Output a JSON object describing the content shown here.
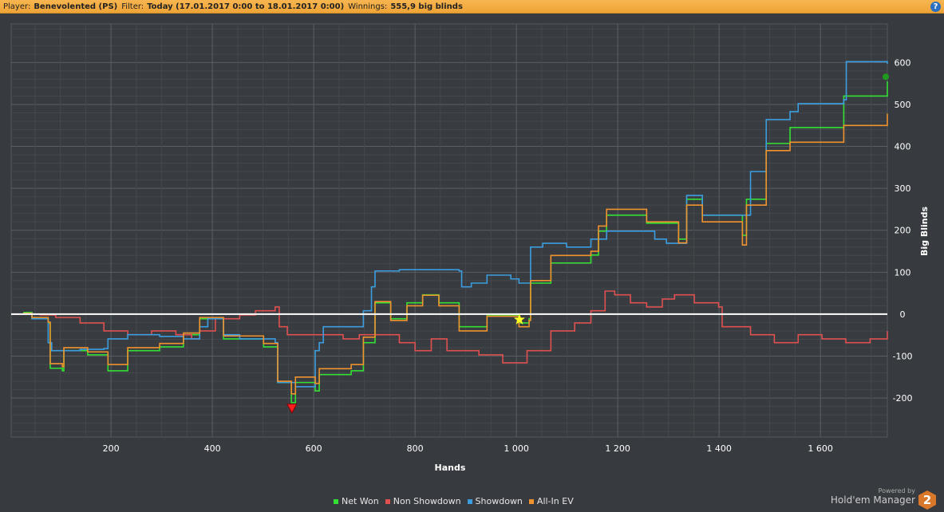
{
  "header": {
    "player_label": "Player:",
    "player": "Benevolented (PS)",
    "filter_label": "Filter:",
    "filter": "Today (17.01.2017 0:00 to 18.01.2017 0:00)",
    "winnings_label": "Winnings:",
    "winnings": "555,9 big blinds",
    "help": "?"
  },
  "branding": {
    "powered_by": "Powered by",
    "name": "Hold'em Manager",
    "logo": "2"
  },
  "chart_data": {
    "type": "line",
    "title": "",
    "xlabel": "Hands",
    "ylabel": "Big Blinds",
    "xlim": [
      3,
      1732
    ],
    "ylim": [
      -293,
      692
    ],
    "x_ticks": [
      200,
      400,
      600,
      800,
      1000,
      1200,
      1400,
      1600
    ],
    "x_tick_labels": [
      "200",
      "400",
      "600",
      "800",
      "1 000",
      "1 200",
      "1 400",
      "1 600"
    ],
    "y_ticks": [
      -200,
      -100,
      0,
      100,
      200,
      300,
      400,
      500,
      600
    ],
    "y_tick_labels": [
      "-200",
      "-100",
      "0",
      "100",
      "200",
      "300",
      "400",
      "500",
      "600"
    ],
    "grid": true,
    "legend_position": "bottom-center",
    "series": [
      {
        "name": "Net Won",
        "color": "#33e033",
        "points": [
          [
            3,
            0
          ],
          [
            28,
            4
          ],
          [
            44,
            -11
          ],
          [
            76,
            -21
          ],
          [
            80,
            -129
          ],
          [
            104,
            -135
          ],
          [
            107,
            -87
          ],
          [
            154,
            -97
          ],
          [
            194,
            -135
          ],
          [
            233,
            -87
          ],
          [
            296,
            -78
          ],
          [
            343,
            -49
          ],
          [
            375,
            -11
          ],
          [
            398,
            -11
          ],
          [
            422,
            -59
          ],
          [
            501,
            -78
          ],
          [
            524,
            -78
          ],
          [
            529,
            -163
          ],
          [
            556,
            -211
          ],
          [
            564,
            -163
          ],
          [
            603,
            -183
          ],
          [
            611,
            -144
          ],
          [
            674,
            -135
          ],
          [
            698,
            -68
          ],
          [
            721,
            27
          ],
          [
            752,
            -11
          ],
          [
            784,
            27
          ],
          [
            815,
            46
          ],
          [
            847,
            27
          ],
          [
            887,
            -30
          ],
          [
            942,
            -2
          ],
          [
            1005,
            -21
          ],
          [
            1025,
            -11
          ],
          [
            1028,
            74
          ],
          [
            1068,
            122
          ],
          [
            1147,
            141
          ],
          [
            1162,
            198
          ],
          [
            1178,
            236
          ],
          [
            1257,
            217
          ],
          [
            1320,
            179
          ],
          [
            1336,
            274
          ],
          [
            1367,
            236
          ],
          [
            1446,
            188
          ],
          [
            1454,
            274
          ],
          [
            1493,
            407
          ],
          [
            1540,
            445
          ],
          [
            1635,
            445
          ],
          [
            1646,
            520
          ],
          [
            1732,
            555
          ]
        ]
      },
      {
        "name": "Non Showdown",
        "color": "#e05050",
        "points": [
          [
            3,
            0
          ],
          [
            60,
            -2
          ],
          [
            91,
            -8
          ],
          [
            139,
            -21
          ],
          [
            186,
            -40
          ],
          [
            233,
            -49
          ],
          [
            280,
            -40
          ],
          [
            328,
            -49
          ],
          [
            359,
            -59
          ],
          [
            375,
            -40
          ],
          [
            406,
            -11
          ],
          [
            454,
            -2
          ],
          [
            485,
            8
          ],
          [
            524,
            17
          ],
          [
            532,
            -30
          ],
          [
            548,
            -49
          ],
          [
            611,
            -49
          ],
          [
            658,
            -59
          ],
          [
            690,
            -49
          ],
          [
            721,
            -49
          ],
          [
            769,
            -68
          ],
          [
            800,
            -87
          ],
          [
            832,
            -59
          ],
          [
            863,
            -87
          ],
          [
            926,
            -97
          ],
          [
            973,
            -116
          ],
          [
            1021,
            -87
          ],
          [
            1052,
            -87
          ],
          [
            1068,
            -40
          ],
          [
            1115,
            -21
          ],
          [
            1147,
            8
          ],
          [
            1175,
            55
          ],
          [
            1194,
            46
          ],
          [
            1225,
            27
          ],
          [
            1257,
            17
          ],
          [
            1288,
            36
          ],
          [
            1312,
            46
          ],
          [
            1351,
            27
          ],
          [
            1399,
            17
          ],
          [
            1406,
            -30
          ],
          [
            1462,
            -49
          ],
          [
            1509,
            -68
          ],
          [
            1556,
            -49
          ],
          [
            1603,
            -59
          ],
          [
            1650,
            -68
          ],
          [
            1698,
            -59
          ],
          [
            1732,
            -40
          ]
        ]
      },
      {
        "name": "Showdown",
        "color": "#3b9de0",
        "points": [
          [
            3,
            0
          ],
          [
            44,
            -11
          ],
          [
            76,
            -68
          ],
          [
            83,
            -87
          ],
          [
            139,
            -84
          ],
          [
            186,
            -82
          ],
          [
            194,
            -59
          ],
          [
            233,
            -49
          ],
          [
            296,
            -53
          ],
          [
            343,
            -59
          ],
          [
            375,
            -30
          ],
          [
            391,
            -11
          ],
          [
            422,
            -49
          ],
          [
            454,
            -59
          ],
          [
            524,
            -68
          ],
          [
            529,
            -163
          ],
          [
            564,
            -173
          ],
          [
            603,
            -87
          ],
          [
            611,
            -68
          ],
          [
            619,
            -30
          ],
          [
            690,
            -30
          ],
          [
            698,
            8
          ],
          [
            714,
            65
          ],
          [
            721,
            103
          ],
          [
            769,
            106
          ],
          [
            887,
            103
          ],
          [
            892,
            65
          ],
          [
            911,
            74
          ],
          [
            942,
            93
          ],
          [
            989,
            84
          ],
          [
            1005,
            74
          ],
          [
            1021,
            74
          ],
          [
            1028,
            160
          ],
          [
            1052,
            169
          ],
          [
            1099,
            160
          ],
          [
            1147,
            179
          ],
          [
            1178,
            198
          ],
          [
            1225,
            198
          ],
          [
            1273,
            179
          ],
          [
            1296,
            169
          ],
          [
            1336,
            283
          ],
          [
            1367,
            236
          ],
          [
            1454,
            236
          ],
          [
            1462,
            340
          ],
          [
            1493,
            464
          ],
          [
            1540,
            483
          ],
          [
            1556,
            502
          ],
          [
            1646,
            511
          ],
          [
            1651,
            602
          ],
          [
            1706,
            602
          ],
          [
            1732,
            597
          ]
        ]
      },
      {
        "name": "All-In EV",
        "color": "#f0922e",
        "points": [
          [
            3,
            0
          ],
          [
            28,
            2
          ],
          [
            44,
            -8
          ],
          [
            76,
            -19
          ],
          [
            80,
            -118
          ],
          [
            104,
            -125
          ],
          [
            107,
            -80
          ],
          [
            154,
            -90
          ],
          [
            194,
            -120
          ],
          [
            233,
            -80
          ],
          [
            296,
            -70
          ],
          [
            343,
            -45
          ],
          [
            375,
            -8
          ],
          [
            398,
            -8
          ],
          [
            422,
            -52
          ],
          [
            501,
            -70
          ],
          [
            524,
            -70
          ],
          [
            529,
            -160
          ],
          [
            556,
            -190
          ],
          [
            564,
            -150
          ],
          [
            603,
            -165
          ],
          [
            611,
            -130
          ],
          [
            674,
            -120
          ],
          [
            698,
            -55
          ],
          [
            721,
            30
          ],
          [
            752,
            -15
          ],
          [
            784,
            20
          ],
          [
            815,
            45
          ],
          [
            847,
            20
          ],
          [
            887,
            -40
          ],
          [
            942,
            -5
          ],
          [
            1005,
            -30
          ],
          [
            1025,
            -15
          ],
          [
            1028,
            80
          ],
          [
            1068,
            140
          ],
          [
            1147,
            150
          ],
          [
            1162,
            210
          ],
          [
            1178,
            250
          ],
          [
            1257,
            220
          ],
          [
            1320,
            170
          ],
          [
            1336,
            260
          ],
          [
            1367,
            220
          ],
          [
            1446,
            165
          ],
          [
            1454,
            260
          ],
          [
            1493,
            390
          ],
          [
            1540,
            410
          ],
          [
            1635,
            410
          ],
          [
            1646,
            450
          ],
          [
            1732,
            478
          ]
        ]
      }
    ],
    "markers": [
      {
        "name": "lowest-point",
        "shape": "triangle-down",
        "color": "#ff2020",
        "x": 557,
        "y": -226
      },
      {
        "name": "highlight-star",
        "shape": "star",
        "color": "#ffff20",
        "x": 1006,
        "y": -13
      },
      {
        "name": "end-point",
        "shape": "circle",
        "color": "#1f9a1f",
        "x": 1732,
        "y": 566
      }
    ]
  }
}
